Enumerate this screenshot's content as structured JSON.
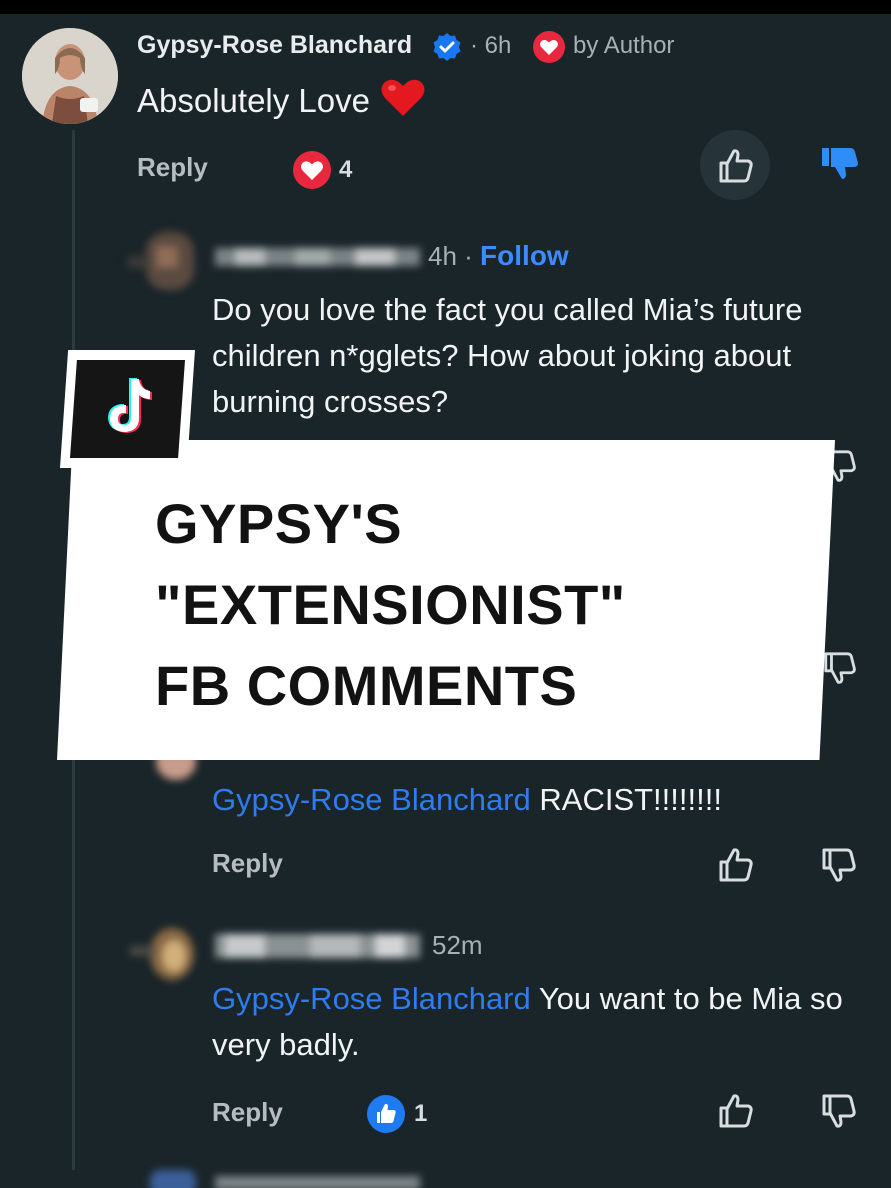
{
  "comments": [
    {
      "author": "Gypsy-Rose Blanchard",
      "time": "· 6h",
      "author_badge": "by Author",
      "text": "Absolutely Love",
      "reply_label": "Reply",
      "reaction_count": "4",
      "reaction_type": "heart"
    },
    {
      "time": "4h ·",
      "follow_label": "Follow",
      "text": "Do you love the fact you called Mia’s future children n*gglets? How about joking about burning crosses?"
    },
    {
      "mention": "Gypsy-Rose Blanchard",
      "text": "RACIST!!!!!!!!",
      "reply_label": "Reply"
    },
    {
      "time": "52m",
      "mention": "Gypsy-Rose Blanchard",
      "text": "You want to be Mia so very badly.",
      "reply_label": "Reply",
      "reaction_count": "1",
      "reaction_type": "like"
    }
  ],
  "overlay": {
    "line1": "GYPSY'S",
    "line2": "\"EXTENSIONIST\"",
    "line3": "FB COMMENTS"
  },
  "icons": {
    "verified": "verified-badge-icon",
    "heart": "heart-reaction-icon",
    "like": "thumbs-up-icon",
    "dislike": "thumbs-down-icon",
    "tiktok": "tiktok-logo-icon"
  },
  "colors": {
    "background": "#1a2529",
    "mention": "#2f7cf0",
    "follow": "#3d8bff",
    "heart": "#e8283f",
    "verified": "#1877f2"
  }
}
